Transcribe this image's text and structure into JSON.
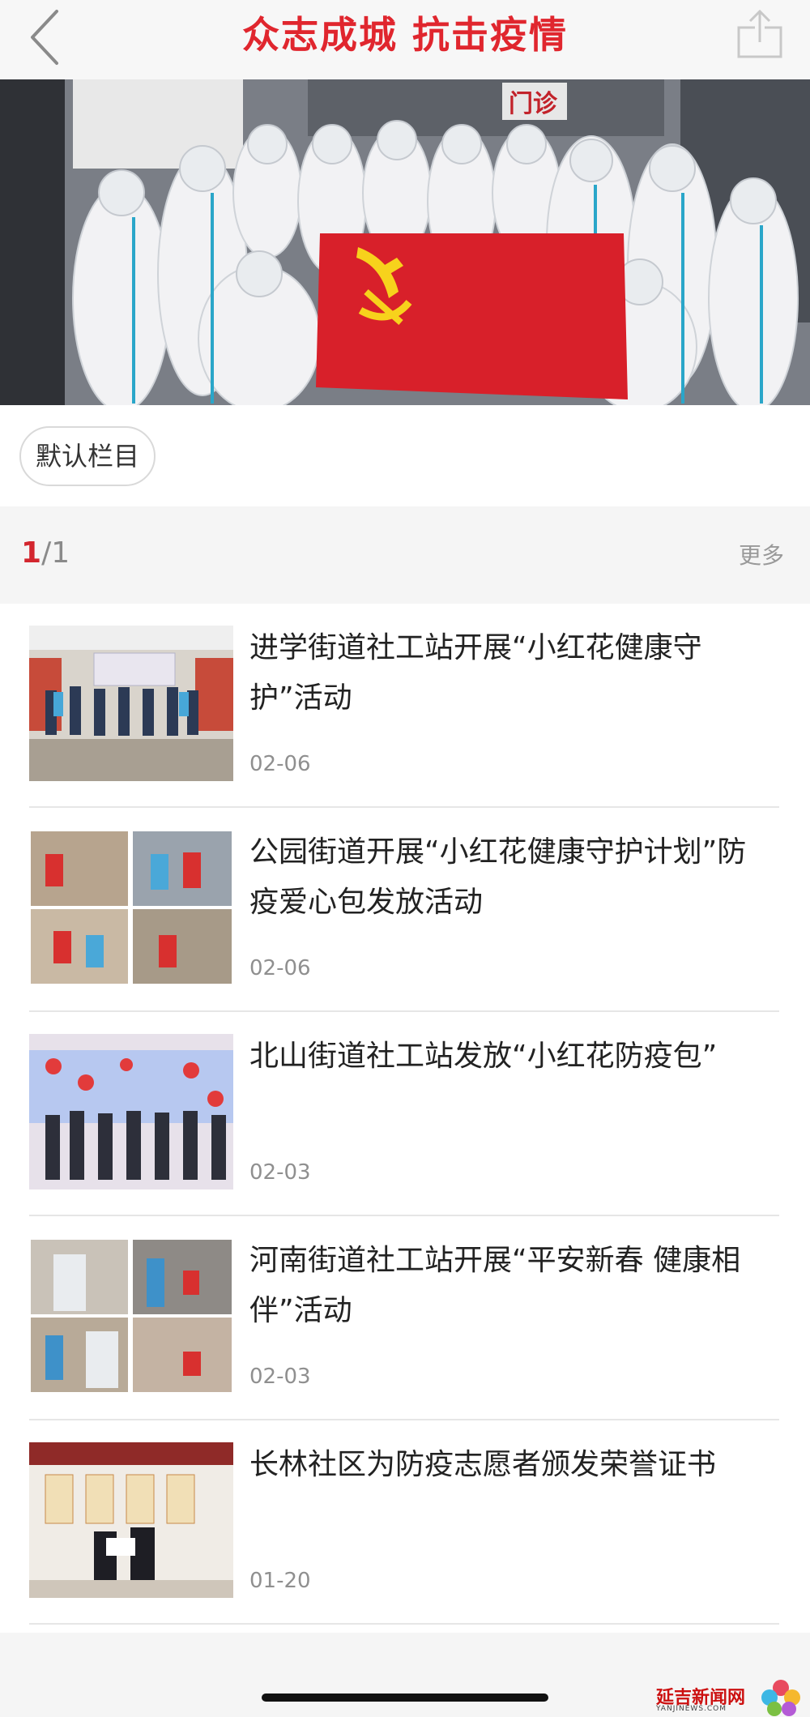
{
  "header": {
    "title": "众志成城  抗击疫情",
    "back_icon": "chevron-left-icon",
    "share_icon": "share-icon"
  },
  "banner": {
    "sign_text": "门诊"
  },
  "column_tag": "默认栏目",
  "pager": {
    "current": "1",
    "separator": "/",
    "total": "1",
    "more_label": "更多"
  },
  "articles": [
    {
      "title": "进学街道社工站开展“小红花健康守护”活动",
      "date": "02-06"
    },
    {
      "title": "公园街道开展“小红花健康守护计划”防疫爱心包发放活动",
      "date": "02-06"
    },
    {
      "title": "北山街道社工站发放“小红花防疫包”",
      "date": "02-03"
    },
    {
      "title": "河南街道社工站开展“平安新春 健康相伴”活动",
      "date": "02-03"
    },
    {
      "title": "长林社区为防疫志愿者颁发荣誉证书",
      "date": "01-20"
    }
  ],
  "watermark": {
    "name": "延吉新闻网",
    "domain": "YANJINEWS.COM"
  },
  "colors": {
    "accent": "#e0262e",
    "flag_red": "#d8202a",
    "flag_gold": "#f7d21c"
  }
}
